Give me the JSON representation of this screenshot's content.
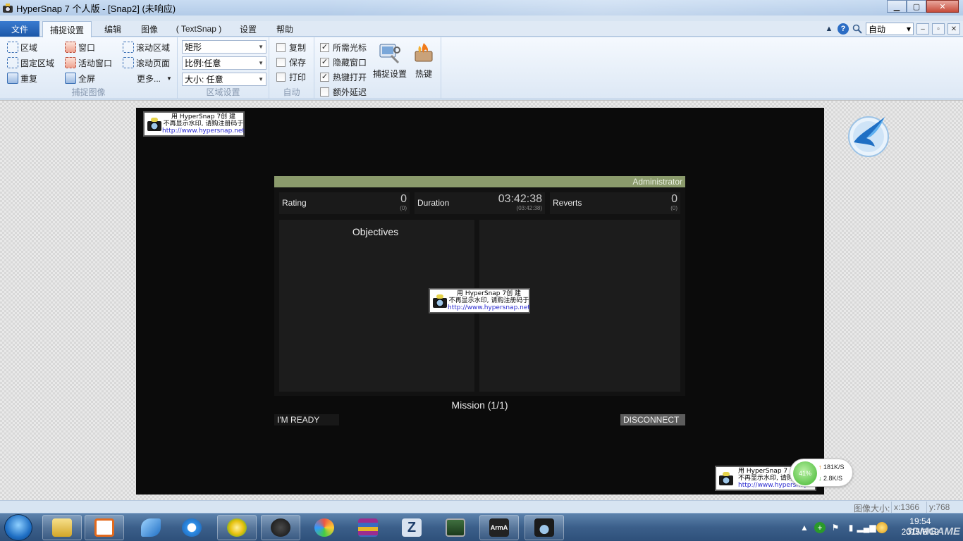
{
  "window": {
    "title": "HyperSnap 7 个人版 - [Snap2] (未响应)",
    "controls": {
      "minimize": "▁",
      "maximize": "▢",
      "close": "✕"
    }
  },
  "ribbon_tabs": {
    "file": "文件",
    "tabs": [
      "捕捉设置",
      "编辑",
      "图像",
      "( TextSnap )",
      "设置",
      "帮助"
    ],
    "active": "捕捉设置"
  },
  "ribbon_right": {
    "mode": "自动",
    "help": "?",
    "search_icon": "magnifier-icon"
  },
  "capture_group": {
    "label": "捕捉图像",
    "region": "区域",
    "fixed_region": "固定区域",
    "repeat": "重复",
    "window": "窗口",
    "active_window": "活动窗口",
    "fullscreen": "全屏",
    "scroll_region": "滚动区域",
    "scroll_page": "滚动页面",
    "more": "更多..."
  },
  "region_group": {
    "label": "区域设置",
    "shape": "矩形",
    "ratio": "比例:任意",
    "size": "大小: 任意"
  },
  "auto_group": {
    "label": "自动",
    "copy": "复制",
    "save": "保存",
    "print": "打印"
  },
  "options_group": {
    "cursor": {
      "label": "所需光标",
      "checked": true
    },
    "hide_window": {
      "label": "隐藏窗口",
      "checked": true
    },
    "hotkey_enable": {
      "label": "热键打开",
      "checked": true
    },
    "extra_delay": {
      "label": "额外延迟",
      "checked": false
    },
    "capture_settings": "捕捉设置",
    "hotkeys": "热键"
  },
  "watermark": {
    "line1": "用 HyperSnap 7创 建",
    "line2": "不再显示水印, 请购注册码于",
    "line3": "http://www.hypersnap.net",
    "line1_cut": "用  HyperSnap 7",
    "line2_cut": "不再显示水印, 请购",
    "line3_cut": "http://www.hypersnap.net"
  },
  "game": {
    "admin": "Administrator",
    "stats": [
      {
        "label": "Rating",
        "value": "0",
        "sub": "(0)"
      },
      {
        "label": "Duration",
        "value": "03:42:38",
        "sub": "(03:42:38)"
      },
      {
        "label": "Reverts",
        "value": "0",
        "sub": "(0)"
      }
    ],
    "objectives": "Objectives",
    "mission": "Mission (1/1)",
    "ready": "I'M READY",
    "disconnect": "DISCONNECT"
  },
  "net_widget": {
    "percent": "41%",
    "up": "181K/S",
    "down": "2.8K/S"
  },
  "statusbar": {
    "image_size": "图像大小:",
    "x": "x:1366",
    "y": "y:768"
  },
  "taskbar": {
    "time": "19:54",
    "date": "2015/6/12",
    "watermark_text": "3DMGAME",
    "apps": [
      "explorer",
      "media-player",
      "bird-app",
      "ie",
      "ball-app",
      "steam",
      "paint",
      "winrar",
      "z-app",
      "gpu-app",
      "arma-alpha",
      "hypersnap"
    ]
  },
  "colors": {
    "accent": "#1c57a8",
    "admin_bar": "#8b9b6c",
    "snap_bg": "#0b0b0b"
  }
}
